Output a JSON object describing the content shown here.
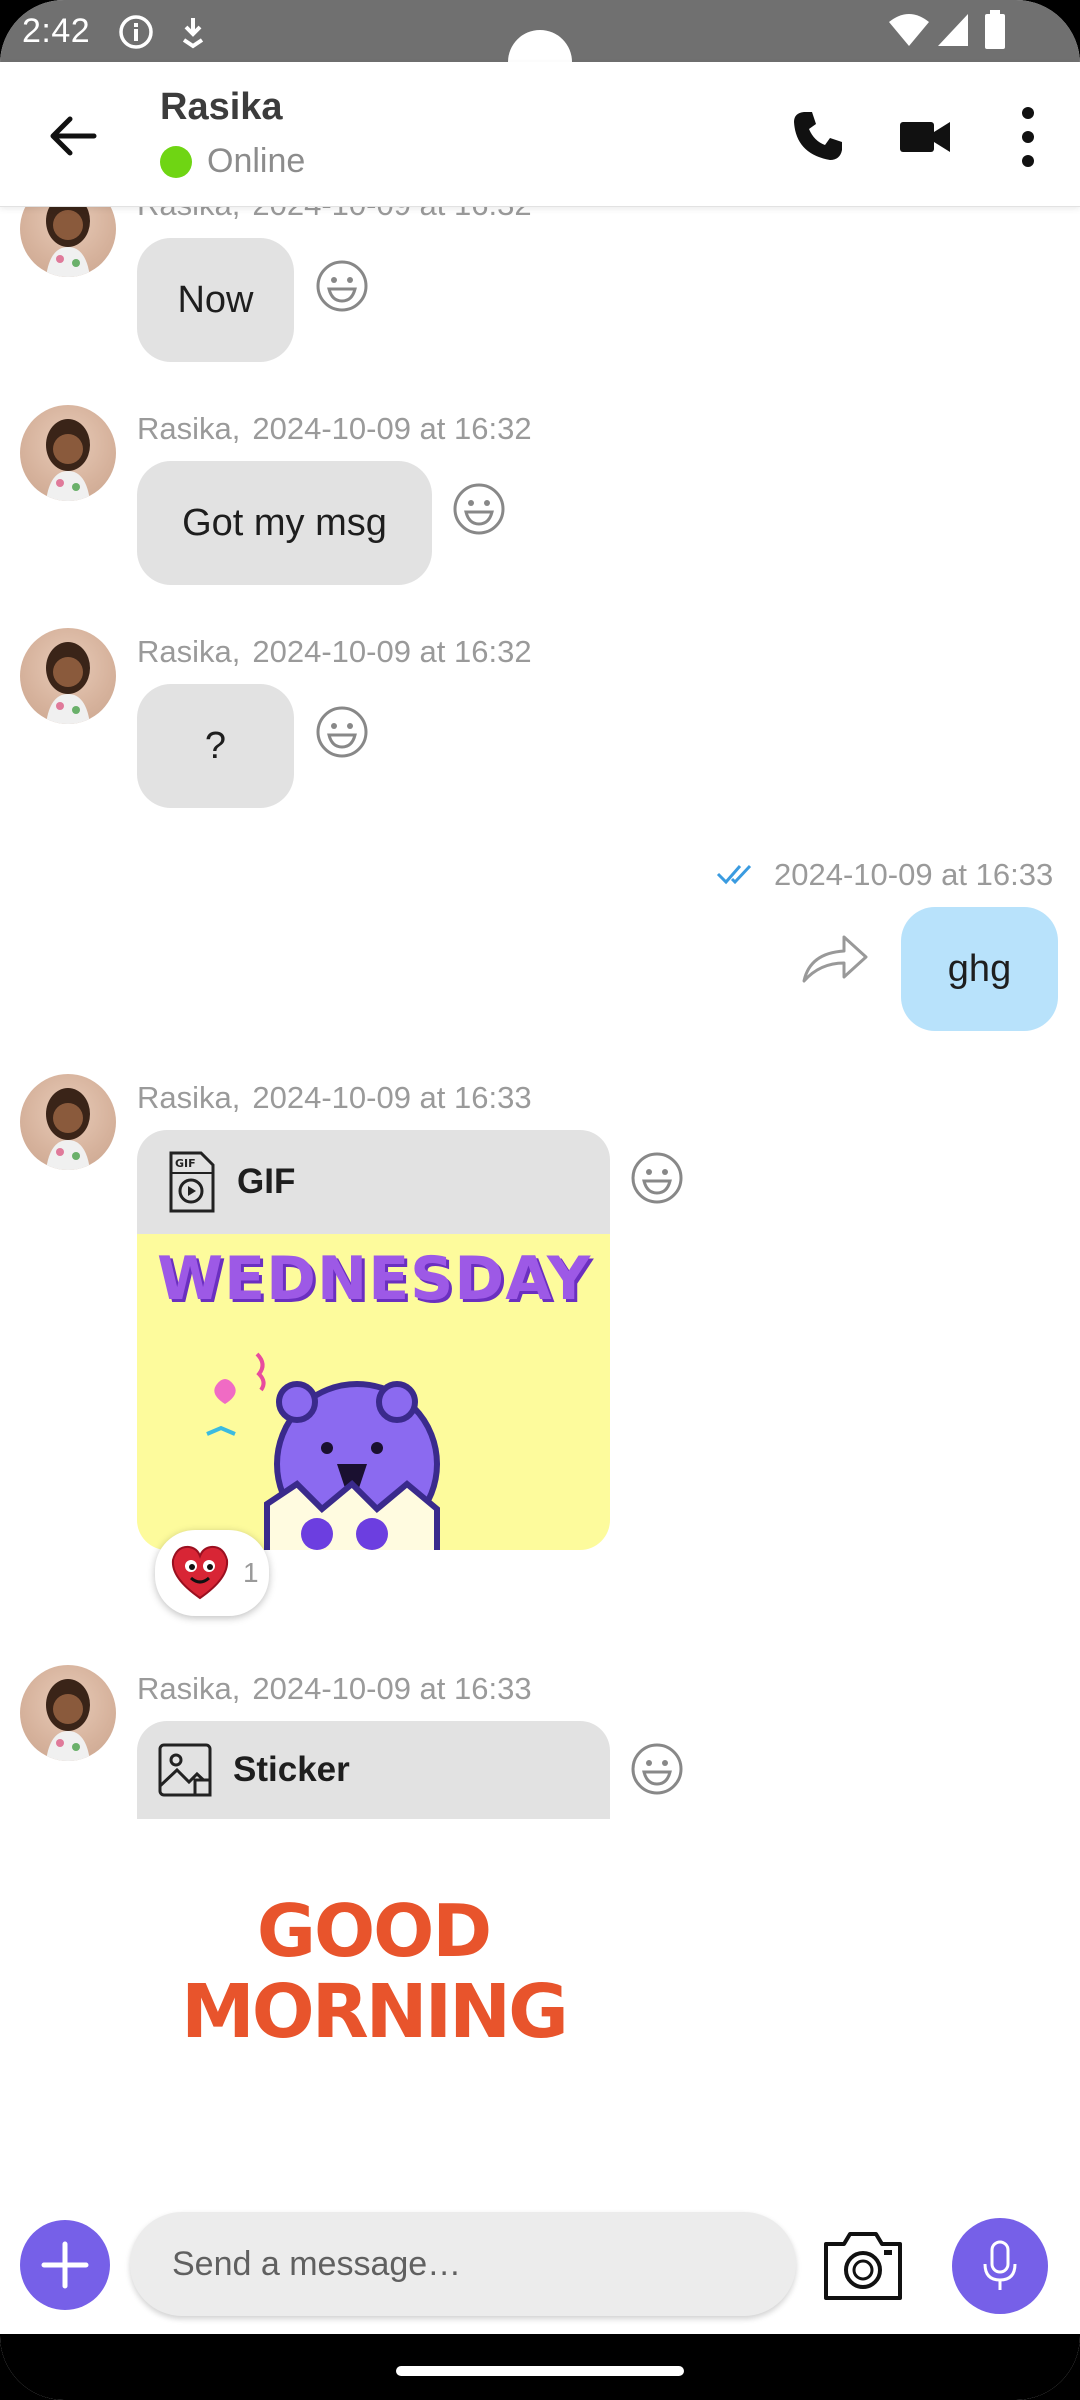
{
  "status_bar": {
    "time": "2:42",
    "icons": [
      "info-icon",
      "download-status-icon",
      "wifi-icon",
      "signal-icon",
      "battery-icon"
    ]
  },
  "header": {
    "name": "Rasika",
    "status": "Online",
    "status_color": "#6fd513",
    "actions": [
      "back-arrow-icon",
      "phone-icon",
      "video-camera-icon",
      "more-vert-icon"
    ]
  },
  "messages": [
    {
      "type": "text",
      "direction": "incoming",
      "sender": "Rasika,",
      "time": "2024-10-09 at 16:32",
      "text": "Now"
    },
    {
      "type": "text",
      "direction": "incoming",
      "sender": "Rasika,",
      "time": "2024-10-09 at 16:32",
      "text": "Got my msg"
    },
    {
      "type": "text",
      "direction": "incoming",
      "sender": "Rasika,",
      "time": "2024-10-09 at 16:32",
      "text": "?"
    },
    {
      "type": "text",
      "direction": "outgoing",
      "time": "2024-10-09 at 16:33",
      "text": "ghg",
      "receipt": "double-check-icon"
    },
    {
      "type": "gif",
      "direction": "incoming",
      "sender": "Rasika,",
      "time": "2024-10-09 at 16:33",
      "label": "GIF",
      "image_text": "WEDNESDAY",
      "reaction": {
        "emoji": "heart-face",
        "count": "1"
      }
    },
    {
      "type": "sticker",
      "direction": "incoming",
      "sender": "Rasika,",
      "time": "2024-10-09 at 16:33",
      "label": "Sticker",
      "sticker_lines": [
        "GOOD",
        "MORNING"
      ]
    }
  ],
  "composer": {
    "placeholder": "Send a message…",
    "actions": [
      "plus-icon",
      "camera-icon",
      "microphone-icon"
    ],
    "accent": "#7660e8"
  },
  "colors": {
    "incoming_bubble": "#e2e2e2",
    "outgoing_bubble": "#b8e2fb",
    "status_bar": "#707070"
  }
}
